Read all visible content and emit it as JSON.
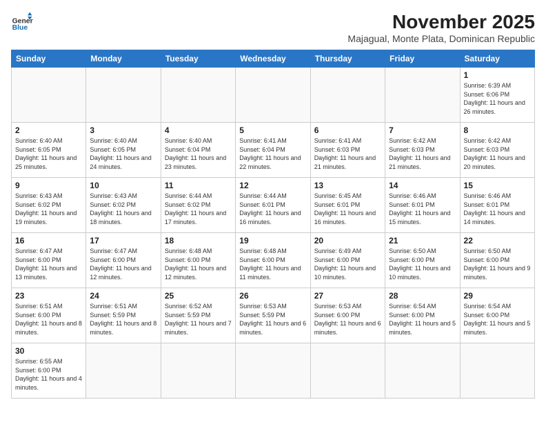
{
  "header": {
    "logo_general": "General",
    "logo_blue": "Blue",
    "title": "November 2025",
    "subtitle": "Majagual, Monte Plata, Dominican Republic"
  },
  "weekdays": [
    "Sunday",
    "Monday",
    "Tuesday",
    "Wednesday",
    "Thursday",
    "Friday",
    "Saturday"
  ],
  "weeks": [
    [
      {
        "day": "",
        "info": ""
      },
      {
        "day": "",
        "info": ""
      },
      {
        "day": "",
        "info": ""
      },
      {
        "day": "",
        "info": ""
      },
      {
        "day": "",
        "info": ""
      },
      {
        "day": "",
        "info": ""
      },
      {
        "day": "1",
        "info": "Sunrise: 6:39 AM\nSunset: 6:06 PM\nDaylight: 11 hours\nand 26 minutes."
      }
    ],
    [
      {
        "day": "2",
        "info": "Sunrise: 6:40 AM\nSunset: 6:05 PM\nDaylight: 11 hours\nand 25 minutes."
      },
      {
        "day": "3",
        "info": "Sunrise: 6:40 AM\nSunset: 6:05 PM\nDaylight: 11 hours\nand 24 minutes."
      },
      {
        "day": "4",
        "info": "Sunrise: 6:40 AM\nSunset: 6:04 PM\nDaylight: 11 hours\nand 23 minutes."
      },
      {
        "day": "5",
        "info": "Sunrise: 6:41 AM\nSunset: 6:04 PM\nDaylight: 11 hours\nand 22 minutes."
      },
      {
        "day": "6",
        "info": "Sunrise: 6:41 AM\nSunset: 6:03 PM\nDaylight: 11 hours\nand 21 minutes."
      },
      {
        "day": "7",
        "info": "Sunrise: 6:42 AM\nSunset: 6:03 PM\nDaylight: 11 hours\nand 21 minutes."
      },
      {
        "day": "8",
        "info": "Sunrise: 6:42 AM\nSunset: 6:03 PM\nDaylight: 11 hours\nand 20 minutes."
      }
    ],
    [
      {
        "day": "9",
        "info": "Sunrise: 6:43 AM\nSunset: 6:02 PM\nDaylight: 11 hours\nand 19 minutes."
      },
      {
        "day": "10",
        "info": "Sunrise: 6:43 AM\nSunset: 6:02 PM\nDaylight: 11 hours\nand 18 minutes."
      },
      {
        "day": "11",
        "info": "Sunrise: 6:44 AM\nSunset: 6:02 PM\nDaylight: 11 hours\nand 17 minutes."
      },
      {
        "day": "12",
        "info": "Sunrise: 6:44 AM\nSunset: 6:01 PM\nDaylight: 11 hours\nand 16 minutes."
      },
      {
        "day": "13",
        "info": "Sunrise: 6:45 AM\nSunset: 6:01 PM\nDaylight: 11 hours\nand 16 minutes."
      },
      {
        "day": "14",
        "info": "Sunrise: 6:46 AM\nSunset: 6:01 PM\nDaylight: 11 hours\nand 15 minutes."
      },
      {
        "day": "15",
        "info": "Sunrise: 6:46 AM\nSunset: 6:01 PM\nDaylight: 11 hours\nand 14 minutes."
      }
    ],
    [
      {
        "day": "16",
        "info": "Sunrise: 6:47 AM\nSunset: 6:00 PM\nDaylight: 11 hours\nand 13 minutes."
      },
      {
        "day": "17",
        "info": "Sunrise: 6:47 AM\nSunset: 6:00 PM\nDaylight: 11 hours\nand 12 minutes."
      },
      {
        "day": "18",
        "info": "Sunrise: 6:48 AM\nSunset: 6:00 PM\nDaylight: 11 hours\nand 12 minutes."
      },
      {
        "day": "19",
        "info": "Sunrise: 6:48 AM\nSunset: 6:00 PM\nDaylight: 11 hours\nand 11 minutes."
      },
      {
        "day": "20",
        "info": "Sunrise: 6:49 AM\nSunset: 6:00 PM\nDaylight: 11 hours\nand 10 minutes."
      },
      {
        "day": "21",
        "info": "Sunrise: 6:50 AM\nSunset: 6:00 PM\nDaylight: 11 hours\nand 10 minutes."
      },
      {
        "day": "22",
        "info": "Sunrise: 6:50 AM\nSunset: 6:00 PM\nDaylight: 11 hours\nand 9 minutes."
      }
    ],
    [
      {
        "day": "23",
        "info": "Sunrise: 6:51 AM\nSunset: 6:00 PM\nDaylight: 11 hours\nand 8 minutes."
      },
      {
        "day": "24",
        "info": "Sunrise: 6:51 AM\nSunset: 5:59 PM\nDaylight: 11 hours\nand 8 minutes."
      },
      {
        "day": "25",
        "info": "Sunrise: 6:52 AM\nSunset: 5:59 PM\nDaylight: 11 hours\nand 7 minutes."
      },
      {
        "day": "26",
        "info": "Sunrise: 6:53 AM\nSunset: 5:59 PM\nDaylight: 11 hours\nand 6 minutes."
      },
      {
        "day": "27",
        "info": "Sunrise: 6:53 AM\nSunset: 6:00 PM\nDaylight: 11 hours\nand 6 minutes."
      },
      {
        "day": "28",
        "info": "Sunrise: 6:54 AM\nSunset: 6:00 PM\nDaylight: 11 hours\nand 5 minutes."
      },
      {
        "day": "29",
        "info": "Sunrise: 6:54 AM\nSunset: 6:00 PM\nDaylight: 11 hours\nand 5 minutes."
      }
    ],
    [
      {
        "day": "30",
        "info": "Sunrise: 6:55 AM\nSunset: 6:00 PM\nDaylight: 11 hours\nand 4 minutes."
      },
      {
        "day": "",
        "info": ""
      },
      {
        "day": "",
        "info": ""
      },
      {
        "day": "",
        "info": ""
      },
      {
        "day": "",
        "info": ""
      },
      {
        "day": "",
        "info": ""
      },
      {
        "day": "",
        "info": ""
      }
    ]
  ]
}
